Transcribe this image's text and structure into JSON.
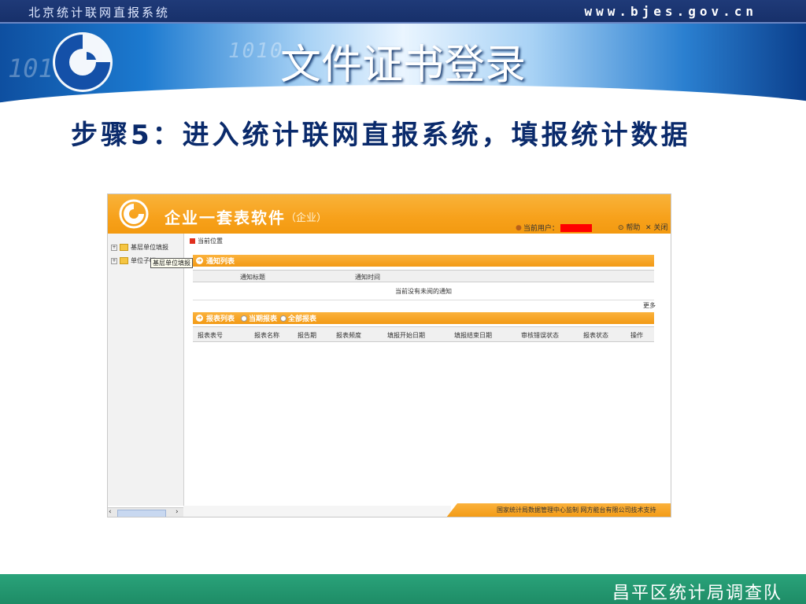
{
  "topbar": {
    "site_name": "北京统计联网直报系统",
    "site_url": "www.bjes.gov.cn"
  },
  "banner": {
    "title": "文件证书登录",
    "logo_icon": "stats-bureau-logo-icon"
  },
  "step": {
    "text": "步骤5：进入统计联网直报系统，填报统计数据"
  },
  "app": {
    "header": {
      "title": "企业一套表软件",
      "subtitle": "（企业）",
      "user_label": "当前用户：",
      "help_label": "帮助",
      "close_label": "关闭"
    },
    "sidebar": {
      "items": [
        {
          "label": "基层单位填报"
        },
        {
          "label": "单位子帐"
        }
      ],
      "tooltip": "基层单位填报"
    },
    "breadcrumb": "当前位置",
    "notices": {
      "section_title": "通知列表",
      "columns": [
        "通知标题",
        "通知时间"
      ],
      "empty_message": "当前没有未阅的通知",
      "more_label": "更多"
    },
    "reports": {
      "section_title": "报表列表",
      "filter_options": [
        "当期报表",
        "全部报表"
      ],
      "columns": [
        "报表表号",
        "报表名称",
        "报告期",
        "报表频度",
        "填报开始日期",
        "填报结束日期",
        "审核错误状态",
        "报表状态",
        "操作"
      ]
    },
    "footer": {
      "text": "国家统计局数据管理中心监制    网方能台有限公司技术支持"
    }
  },
  "bottombar": {
    "org": "昌平区统计局调查队"
  },
  "colors": {
    "header_blue": "#1f3a78",
    "app_orange": "#f7a11b",
    "footer_green": "#2aa37a",
    "step_text": "#0a2a6b"
  }
}
